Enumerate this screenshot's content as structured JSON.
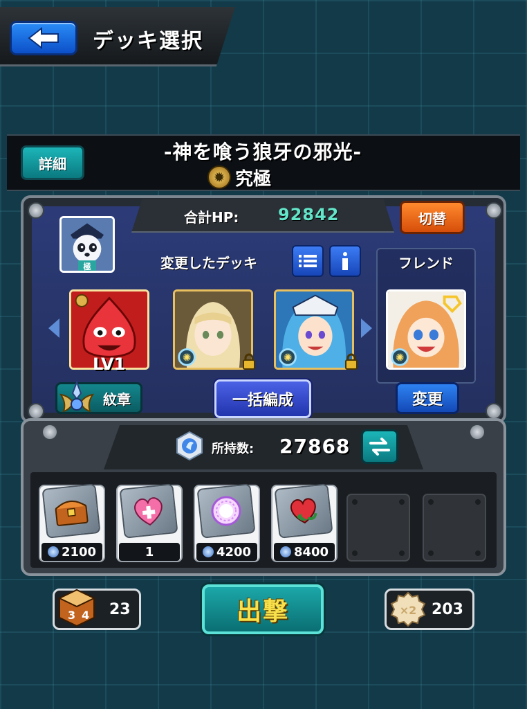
{
  "header": {
    "title": "デッキ選択"
  },
  "quest": {
    "detail_label": "詳細",
    "title": "-神を喰う狼牙の邪光-",
    "difficulty": "究極"
  },
  "deck": {
    "hp_label": "合計HP:",
    "hp_value": "92842",
    "switch_label": "切替",
    "deck_name": "変更したデッキ",
    "friend_label": "フレンド",
    "slot1_level": "LV1",
    "emblem_label": "紋章",
    "batch_label": "一括編成",
    "change_label": "変更"
  },
  "items": {
    "currency_label": "所持数:",
    "currency_value": "27868",
    "list": [
      {
        "icon": "treasure-chest-icon",
        "cost": "2100",
        "orb": true
      },
      {
        "icon": "heart-plus-icon",
        "cost": "1",
        "orb": false
      },
      {
        "icon": "magic-orb-icon",
        "cost": "4200",
        "orb": true
      },
      {
        "icon": "heart-bomb-icon",
        "cost": "8400",
        "orb": true
      }
    ]
  },
  "bottom": {
    "stamina_value": "23",
    "sortie_label": "出撃",
    "ticket_value": "203"
  }
}
